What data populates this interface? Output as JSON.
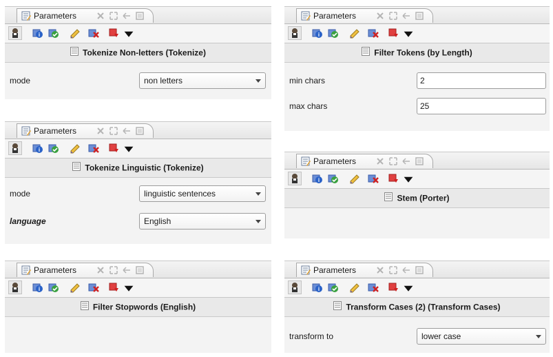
{
  "tab_title": "Parameters",
  "panels": [
    {
      "operator_title": "Tokenize Non-letters (Tokenize)",
      "params": [
        {
          "label": "mode",
          "value": "non letters",
          "type": "select"
        }
      ]
    },
    {
      "operator_title": "Filter Tokens (by Length)",
      "params": [
        {
          "label": "min chars",
          "value": "2",
          "type": "text"
        },
        {
          "label": "max chars",
          "value": "25",
          "type": "text"
        }
      ]
    },
    {
      "operator_title": "Tokenize Linguistic (Tokenize)",
      "params": [
        {
          "label": "mode",
          "value": "linguistic sentences",
          "type": "select"
        },
        {
          "label": "language",
          "value": "English",
          "type": "select",
          "emphasis": "bold-italic"
        }
      ]
    },
    {
      "operator_title": "Stem (Porter)",
      "params": []
    },
    {
      "operator_title": "Filter Stopwords (English)",
      "params": []
    },
    {
      "operator_title": "Transform Cases (2) (Transform Cases)",
      "params": [
        {
          "label": "transform to",
          "value": "lower case",
          "type": "select"
        }
      ]
    }
  ],
  "toolbar_icons": [
    "expert-mode-icon",
    "info-icon",
    "apply-icon",
    "edit-icon",
    "delete-icon",
    "operator-menu-icon",
    "dropdown-icon"
  ],
  "colors": {
    "panel_bg": "#f3f3f3",
    "header_bg": "#e9e9e9",
    "border": "#9c9c9c"
  }
}
